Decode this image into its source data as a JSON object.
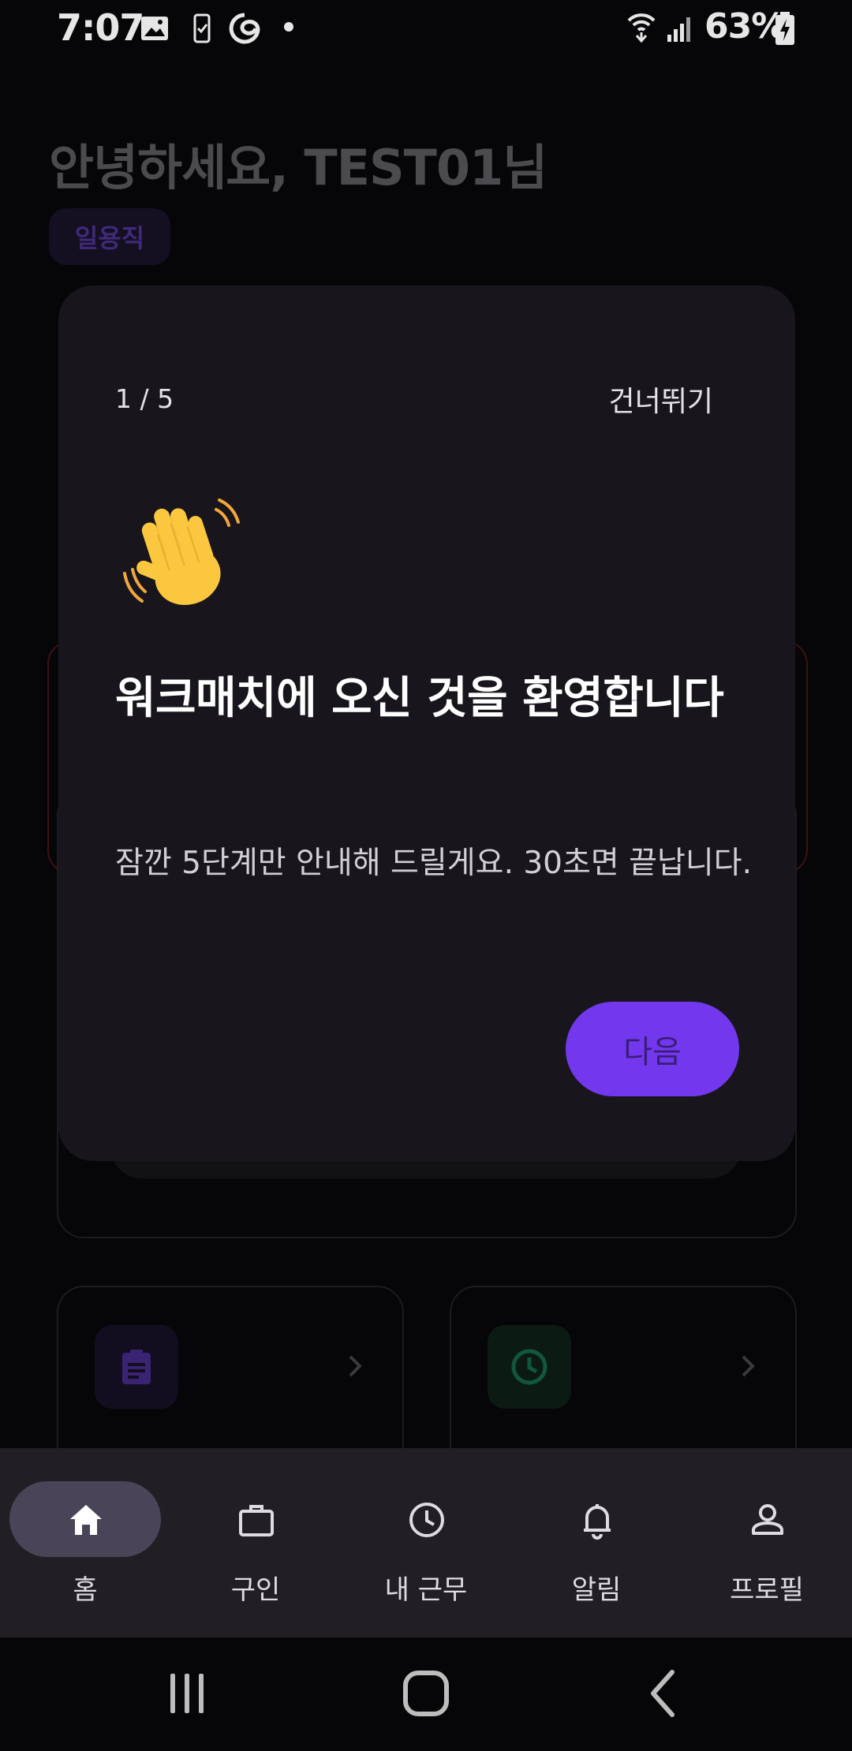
{
  "status_bar": {
    "time": "7:07",
    "battery": "63%",
    "icons": [
      "gallery-icon",
      "phone-check-icon",
      "edge-icon",
      "wifi-icon",
      "signal-icon",
      "battery-charging-icon"
    ]
  },
  "background": {
    "greeting": "안녕하세요, TEST01님",
    "role_chip": "일용직"
  },
  "modal": {
    "step": "1 / 5",
    "skip_label": "건너뛰기",
    "emoji": "waving-hand-icon",
    "title": "워크매치에 오신 것을 환영합니다",
    "description": "잠깐 5단계만 안내해 드릴게요. 30초면 끝납니다.",
    "next_label": "다음"
  },
  "bottom_nav": {
    "items": [
      {
        "label": "홈",
        "icon": "home-icon",
        "active": true
      },
      {
        "label": "구인",
        "icon": "briefcase-icon",
        "active": false
      },
      {
        "label": "내 근무",
        "icon": "clock-icon",
        "active": false
      },
      {
        "label": "알림",
        "icon": "bell-icon",
        "active": false
      },
      {
        "label": "프로필",
        "icon": "person-icon",
        "active": false
      }
    ]
  },
  "colors": {
    "accent": "#7338ee",
    "modal_bg": "#18161c",
    "nav_bg": "#211f24",
    "nav_active_pill": "#4a4459"
  }
}
